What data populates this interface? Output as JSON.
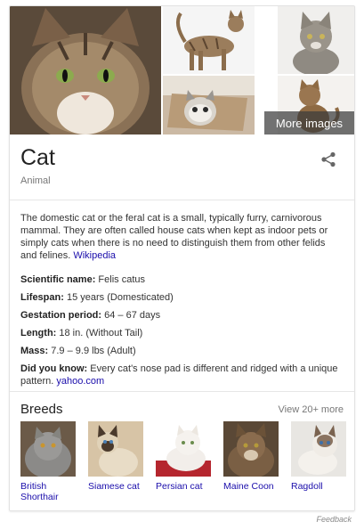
{
  "gallery": {
    "more_images_label": "More images"
  },
  "entity": {
    "title": "Cat",
    "subtitle": "Animal"
  },
  "description": {
    "text": "The domestic cat or the feral cat is a small, typically furry, carnivorous mammal. They are often called house cats when kept as indoor pets or simply cats when there is no need to distinguish them from other felids and felines.",
    "source_link": "Wikipedia"
  },
  "facts": [
    {
      "label": "Scientific name:",
      "value": "Felis catus"
    },
    {
      "label": "Lifespan:",
      "value": "15 years (Domesticated)"
    },
    {
      "label": "Gestation period:",
      "value": "64 – 67 days"
    },
    {
      "label": "Length:",
      "value": "18 in. (Without Tail)"
    },
    {
      "label": "Mass:",
      "value": "7.9 – 9.9 lbs (Adult)"
    }
  ],
  "did_you_know": {
    "label": "Did you know:",
    "value": "Every cat's nose pad is different and ridged with a unique pattern.",
    "source_link": "yahoo.com"
  },
  "breeds": {
    "title": "Breeds",
    "view_more": "View 20+ more",
    "items": [
      {
        "label": "British Shorthair"
      },
      {
        "label": "Siamese cat"
      },
      {
        "label": "Persian cat"
      },
      {
        "label": "Maine Coon"
      },
      {
        "label": "Ragdoll"
      }
    ]
  },
  "feedback": "Feedback",
  "colors": {
    "link": "#1a0dab",
    "muted": "#777777"
  },
  "icons": [
    "share-icon"
  ]
}
